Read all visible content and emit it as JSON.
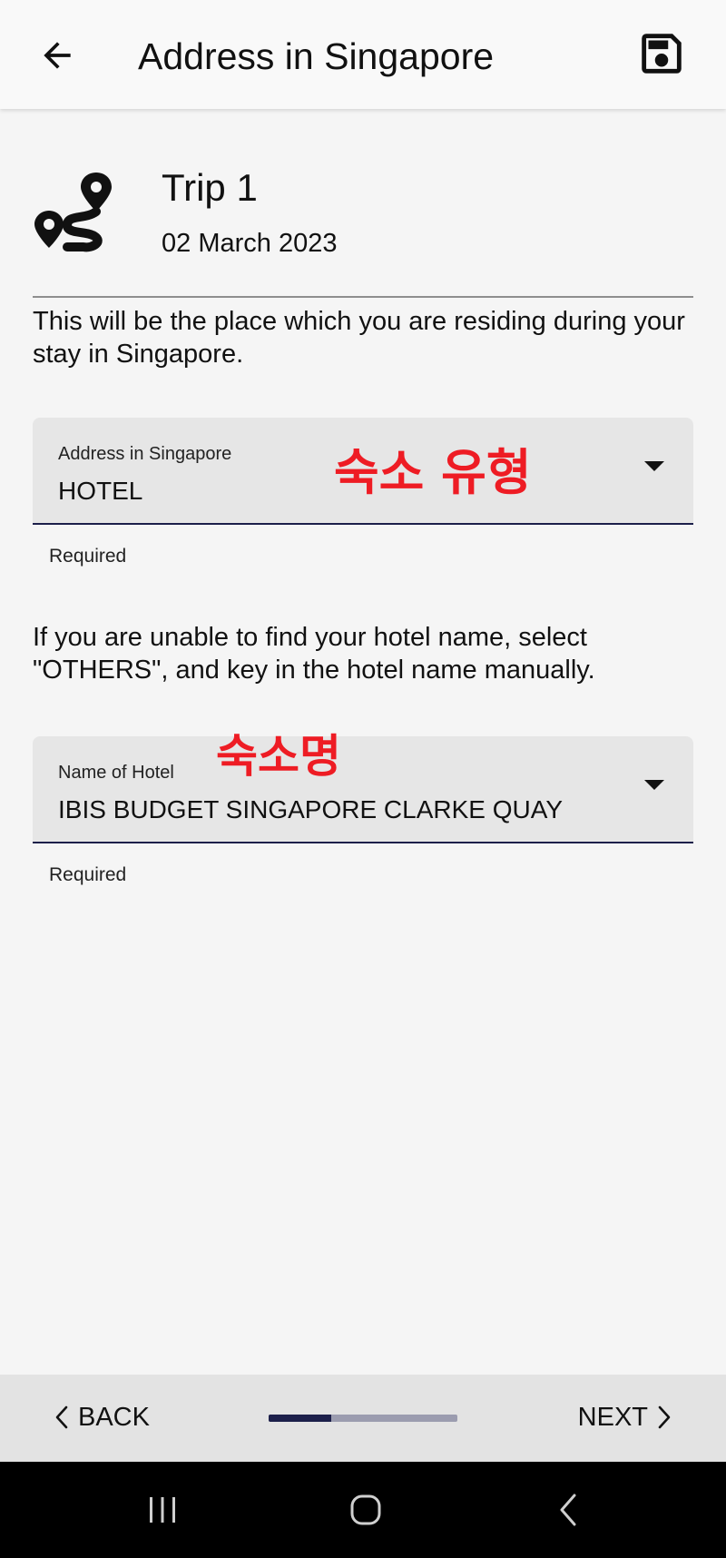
{
  "app_bar": {
    "title": "Address in Singapore",
    "back_icon": "arrow-left-icon",
    "save_icon": "floppy-disk-icon"
  },
  "trip": {
    "name": "Trip 1",
    "date": "02 March 2023",
    "icon": "route-pin-icon"
  },
  "intro_text": "This will be the place which you are residing during your stay in Singapore.",
  "address_field": {
    "label": "Address in Singapore",
    "value": "HOTEL",
    "helper": "Required",
    "annotation": "숙소 유형"
  },
  "info_text": "If you are unable to find your hotel name, select \"OTHERS\", and key in the hotel name manually.",
  "hotel_field": {
    "label": "Name of Hotel",
    "value": "IBIS BUDGET SINGAPORE CLARKE QUAY",
    "helper": "Required",
    "annotation": "숙소명"
  },
  "bottom_nav": {
    "back_label": "BACK",
    "next_label": "NEXT",
    "progress": 0.33
  },
  "colors": {
    "accent": "#1c1f4a",
    "progress_track": "#9b9caf",
    "annotation": "#ee1c24",
    "field_bg": "#e6e6e6"
  }
}
